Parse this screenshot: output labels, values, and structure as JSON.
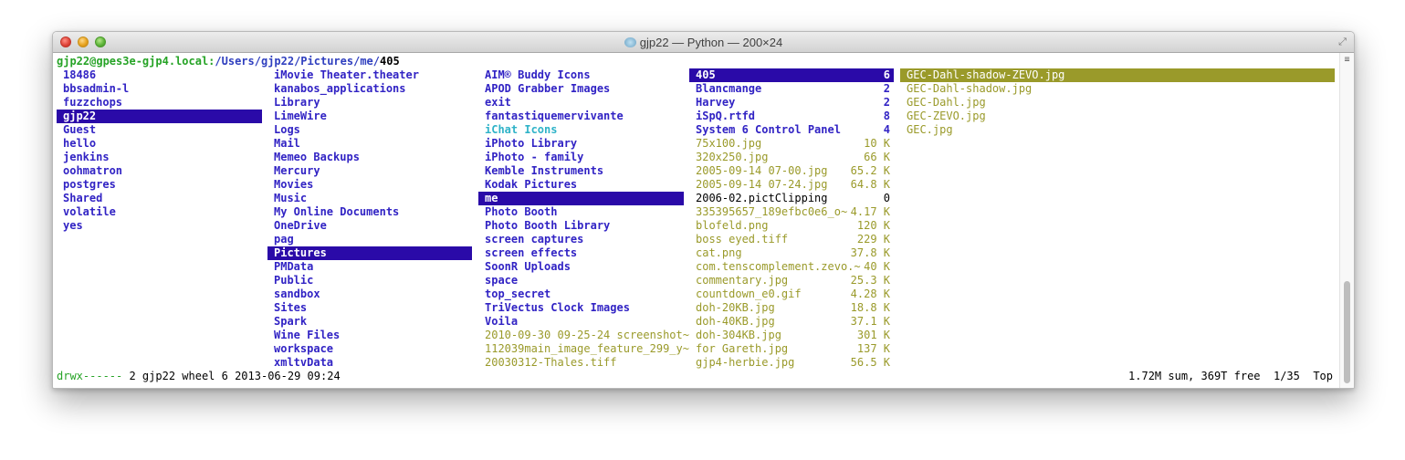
{
  "window": {
    "title": "gjp22 — Python — 200×24",
    "proxy_icon": "folder-proxy-icon",
    "fullscreen_icon": "fullscreen-arrows-icon"
  },
  "path": {
    "host": "gjp22@gpes3e-gjp4.local:",
    "dir": "/Users/gjp22/Pictures/me/",
    "current": "405"
  },
  "columns": [
    {
      "entries": [
        {
          "name": "18486",
          "kind": "dir"
        },
        {
          "name": "bbsadmin-l",
          "kind": "dir"
        },
        {
          "name": "fuzzchops",
          "kind": "dir"
        },
        {
          "name": "gjp22",
          "kind": "dir",
          "selected": true
        },
        {
          "name": "Guest",
          "kind": "dir"
        },
        {
          "name": "hello",
          "kind": "dir"
        },
        {
          "name": "jenkins",
          "kind": "dir"
        },
        {
          "name": "oohmatron",
          "kind": "dir"
        },
        {
          "name": "postgres",
          "kind": "dir"
        },
        {
          "name": "Shared",
          "kind": "dir"
        },
        {
          "name": "volatile",
          "kind": "dir"
        },
        {
          "name": "yes",
          "kind": "dir"
        }
      ]
    },
    {
      "entries": [
        {
          "name": "iMovie Theater.theater",
          "kind": "dir"
        },
        {
          "name": "kanabos_applications",
          "kind": "dir"
        },
        {
          "name": "Library",
          "kind": "dir"
        },
        {
          "name": "LimeWire",
          "kind": "dir"
        },
        {
          "name": "Logs",
          "kind": "dir"
        },
        {
          "name": "Mail",
          "kind": "dir"
        },
        {
          "name": "Memeo Backups",
          "kind": "dir"
        },
        {
          "name": "Mercury",
          "kind": "dir"
        },
        {
          "name": "Movies",
          "kind": "dir"
        },
        {
          "name": "Music",
          "kind": "dir"
        },
        {
          "name": "My Online Documents",
          "kind": "dir"
        },
        {
          "name": "OneDrive",
          "kind": "dir"
        },
        {
          "name": "pag",
          "kind": "dir"
        },
        {
          "name": "Pictures",
          "kind": "dir",
          "selected": true
        },
        {
          "name": "PMData",
          "kind": "dir"
        },
        {
          "name": "Public",
          "kind": "dir"
        },
        {
          "name": "sandbox",
          "kind": "dir"
        },
        {
          "name": "Sites",
          "kind": "dir"
        },
        {
          "name": "Spark",
          "kind": "dir"
        },
        {
          "name": "Wine Files",
          "kind": "dir"
        },
        {
          "name": "workspace",
          "kind": "dir"
        },
        {
          "name": "xmltvData",
          "kind": "dir"
        }
      ]
    },
    {
      "entries": [
        {
          "name": "AIM® Buddy Icons",
          "kind": "dir"
        },
        {
          "name": "APOD Grabber Images",
          "kind": "dir"
        },
        {
          "name": "exit",
          "kind": "dir"
        },
        {
          "name": "fantastiquemervivante",
          "kind": "dir"
        },
        {
          "name": "iChat Icons",
          "kind": "link"
        },
        {
          "name": "iPhoto Library",
          "kind": "dir"
        },
        {
          "name": "iPhoto - family",
          "kind": "dir"
        },
        {
          "name": "Kemble Instruments",
          "kind": "dir"
        },
        {
          "name": "Kodak Pictures",
          "kind": "dir"
        },
        {
          "name": "me",
          "kind": "dir",
          "selected": true
        },
        {
          "name": "Photo Booth",
          "kind": "dir"
        },
        {
          "name": "Photo Booth Library",
          "kind": "dir"
        },
        {
          "name": "screen captures",
          "kind": "dir"
        },
        {
          "name": "screen effects",
          "kind": "dir"
        },
        {
          "name": "SoonR Uploads",
          "kind": "dir"
        },
        {
          "name": "space",
          "kind": "dir"
        },
        {
          "name": "top_secret",
          "kind": "dir"
        },
        {
          "name": "TriVectus Clock Images",
          "kind": "dir"
        },
        {
          "name": "Voila",
          "kind": "dir"
        },
        {
          "name": "2010-09-30 09-25-24 screenshot~",
          "kind": "file"
        },
        {
          "name": "112039main_image_feature_299_y~",
          "kind": "file"
        },
        {
          "name": "20030312-Thales.tiff",
          "kind": "file"
        }
      ]
    },
    {
      "entries": [
        {
          "name": "405",
          "kind": "dir",
          "size": "6",
          "selected": true
        },
        {
          "name": "Blancmange",
          "kind": "dir",
          "size": "2"
        },
        {
          "name": "Harvey",
          "kind": "dir",
          "size": "2"
        },
        {
          "name": "iSpQ.rtfd",
          "kind": "dir",
          "size": "8"
        },
        {
          "name": "System 6 Control Panel",
          "kind": "dir",
          "size": "4"
        },
        {
          "name": "75x100.jpg",
          "kind": "file",
          "size": "10 K"
        },
        {
          "name": "320x250.jpg",
          "kind": "file",
          "size": "66 K"
        },
        {
          "name": "2005-09-14 07-00.jpg",
          "kind": "file",
          "size": "65.2 K"
        },
        {
          "name": "2005-09-14 07-24.jpg",
          "kind": "file",
          "size": "64.8 K"
        },
        {
          "name": "2006-02.pictClipping",
          "kind": "plain",
          "size": "0"
        },
        {
          "name": "335395657_189efbc0e6_o~",
          "kind": "file",
          "size": "4.17 K"
        },
        {
          "name": "blofeld.png",
          "kind": "file",
          "size": "120 K"
        },
        {
          "name": "boss eyed.tiff",
          "kind": "file",
          "size": "229 K"
        },
        {
          "name": "cat.png",
          "kind": "file",
          "size": "37.8 K"
        },
        {
          "name": "com.tenscomplement.zevo.~",
          "kind": "file",
          "size": "40 K"
        },
        {
          "name": "commentary.jpg",
          "kind": "file",
          "size": "25.3 K"
        },
        {
          "name": "countdown_e0.gif",
          "kind": "file",
          "size": "4.28 K"
        },
        {
          "name": "doh-20KB.jpg",
          "kind": "file",
          "size": "18.8 K"
        },
        {
          "name": "doh-40KB.jpg",
          "kind": "file",
          "size": "37.1 K"
        },
        {
          "name": "doh-304KB.jpg",
          "kind": "file",
          "size": "301 K"
        },
        {
          "name": "for Gareth.jpg",
          "kind": "file",
          "size": "137 K"
        },
        {
          "name": "gjp4-herbie.jpg",
          "kind": "file",
          "size": "56.5 K"
        }
      ]
    },
    {
      "entries": [
        {
          "name": "GEC-Dahl-shadow-ZEVO.jpg",
          "kind": "file",
          "selected": true
        },
        {
          "name": "GEC-Dahl-shadow.jpg",
          "kind": "file"
        },
        {
          "name": "GEC-Dahl.jpg",
          "kind": "file"
        },
        {
          "name": "GEC-ZEVO.jpg",
          "kind": "file"
        },
        {
          "name": "GEC.jpg",
          "kind": "file"
        }
      ]
    }
  ],
  "status": {
    "perms": "drwx------",
    "info": " 2 gjp22 wheel 6 2013-06-29 09:24",
    "right": "1.72M sum, 369T free  1/35  Top"
  },
  "colors": {
    "directory": "#3123c4",
    "file": "#9a9a2a",
    "selection": "#2a0aa8",
    "link": "#2fb3c8",
    "host": "#26a326"
  }
}
